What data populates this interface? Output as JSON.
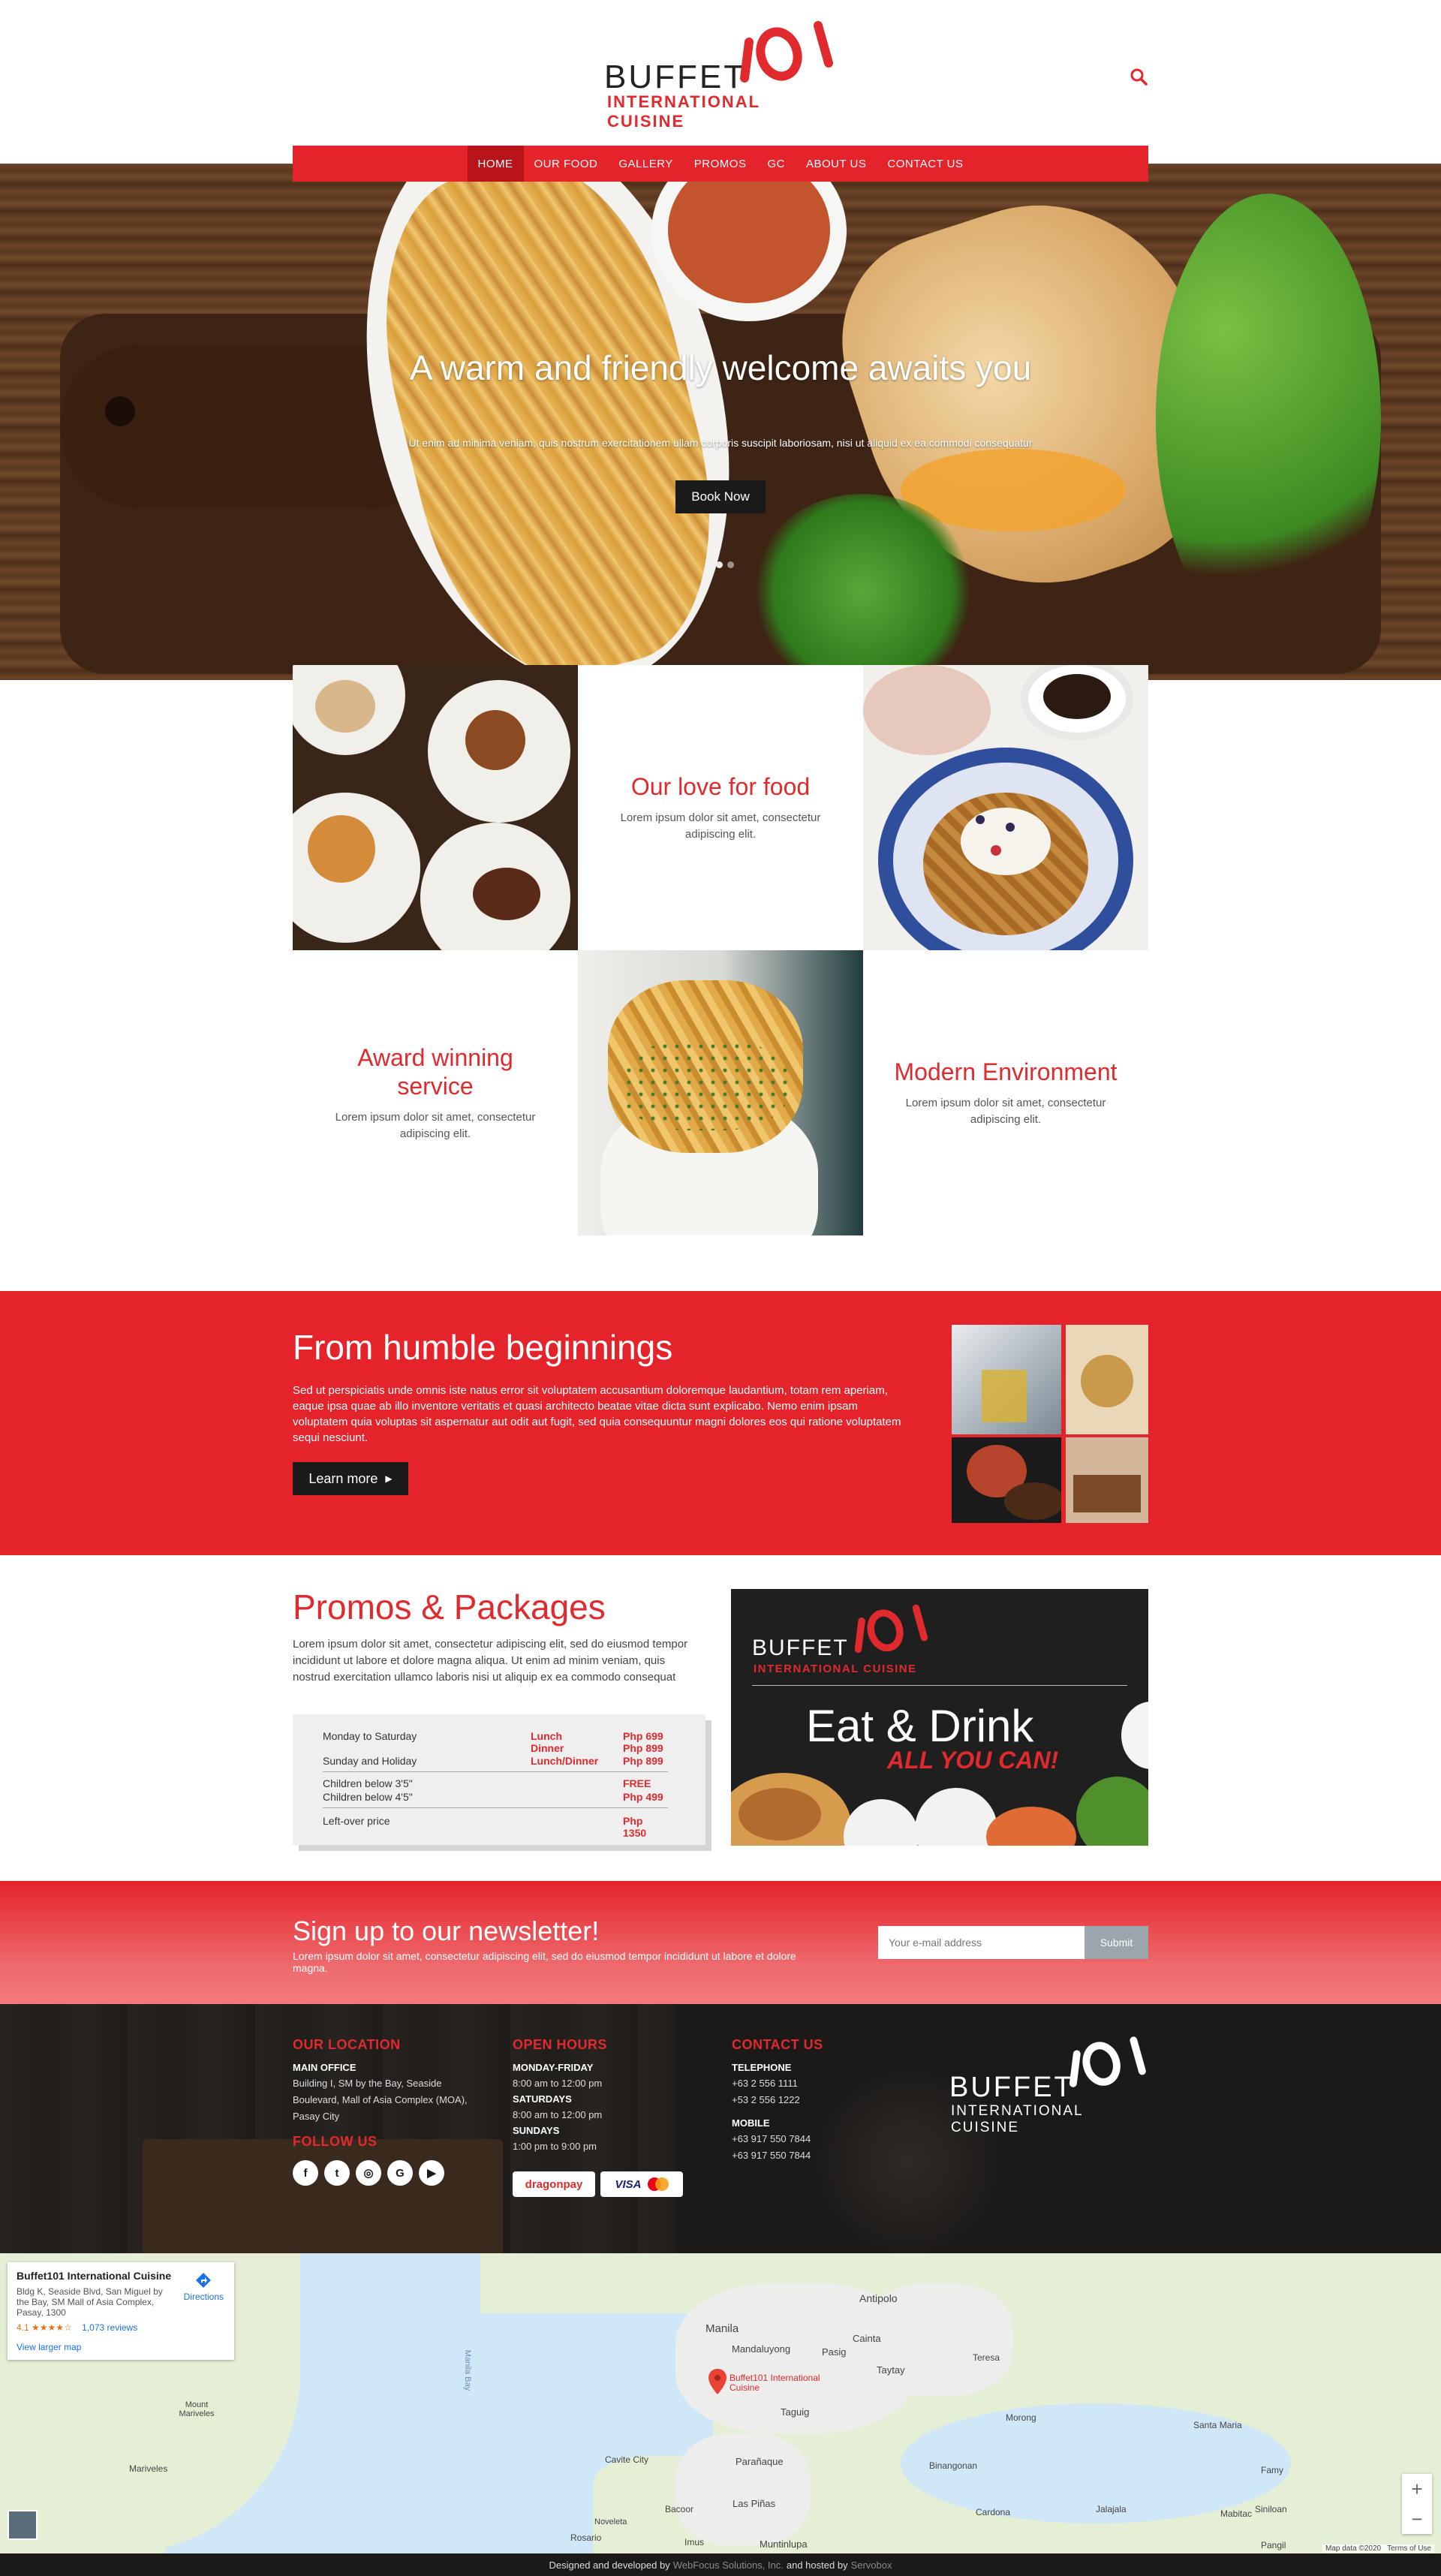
{
  "logo": {
    "buffet": "BUFFET",
    "num": "101",
    "international": "INTERNATIONAL CUISINE"
  },
  "nav": {
    "items": [
      "HOME",
      "OUR FOOD",
      "GALLERY",
      "PROMOS",
      "GC",
      "ABOUT US",
      "CONTACT US"
    ],
    "active": "HOME"
  },
  "hero": {
    "title": "A warm and friendly welcome awaits you",
    "subtitle": "Ut enim ad minima veniam, quis nostrum exercitationem ullam corporis suscipit laboriosam, nisi ut aliquid ex ea commodi consequatur",
    "button": "Book Now"
  },
  "features": [
    {
      "title": "Our love for food",
      "text": "Lorem ipsum dolor sit amet, consectetur adipiscing elit."
    },
    {
      "title": "Award winning service",
      "text": "Lorem ipsum dolor sit amet, consectetur adipiscing elit."
    },
    {
      "title": "Modern Environment",
      "text": "Lorem ipsum dolor sit amet, consectetur adipiscing elit."
    }
  ],
  "humble": {
    "title": "From humble beginnings",
    "text": "Sed ut perspiciatis unde omnis iste natus error sit voluptatem accusantium doloremque laudantium, totam rem aperiam, eaque ipsa quae ab illo inventore veritatis et quasi architecto beatae vitae dicta sunt explicabo. Nemo enim ipsam voluptatem quia voluptas sit aspernatur aut odit aut fugit, sed quia consequuntur magni dolores eos qui ratione voluptatem sequi nesciunt.",
    "button": "Learn more"
  },
  "promos": {
    "title": "Promos & Packages",
    "text": "Lorem ipsum dolor sit amet, consectetur adipiscing elit, sed do eiusmod tempor incididunt ut labore et dolore magna aliqua. Ut enim ad minim veniam, quis nostrud exercitation ullamco laboris nisi ut aliquip ex ea commodo consequat",
    "rows": [
      {
        "label": "Monday to Saturday",
        "meal": "Lunch",
        "price": "Php 699"
      },
      {
        "label": "",
        "meal": "Dinner",
        "price": "Php 899"
      },
      {
        "label": "Sunday and Holiday",
        "meal": "Lunch/Dinner",
        "price": "Php 899"
      },
      {
        "label": "Children below 3'5\"",
        "meal": "",
        "price": "FREE"
      },
      {
        "label": "Children below 4'5\"",
        "meal": "",
        "price": "Php 499"
      },
      {
        "label": "Left-over price",
        "meal": "",
        "price": "Php 1350"
      }
    ],
    "ad": {
      "buffet": "BUFFET",
      "international": "INTERNATIONAL CUISINE",
      "eat": "Eat & Drink",
      "all": "ALL YOU CAN!"
    }
  },
  "newsletter": {
    "title": "Sign up to our newsletter!",
    "text": "Lorem ipsum dolor sit amet, consectetur adipiscing elit, sed do eiusmod tempor incididunt ut labore et dolore magna.",
    "placeholder": "Your e-mail address",
    "submit": "Submit"
  },
  "footer": {
    "location": {
      "title": "OUR LOCATION",
      "key": "MAIN OFFICE",
      "address": "Building I, SM by the Bay, Seaside Boulevard, Mall of Asia Complex (MOA), Pasay City"
    },
    "follow": "FOLLOW US",
    "hours": {
      "title": "OPEN HOURS",
      "rows": [
        {
          "k": "MONDAY-FRIDAY",
          "v": "8:00 am to 12:00 pm"
        },
        {
          "k": "SATURDAYS",
          "v": "8:00 am to 12:00 pm"
        },
        {
          "k": "SUNDAYS",
          "v": "1:00 pm to 9:00 pm"
        }
      ]
    },
    "contact": {
      "title": "CONTACT US",
      "tel_label": "TELEPHONE",
      "tel": [
        "+63 2 556 1111",
        "+53 2 556 1222"
      ],
      "mob_label": "MOBILE",
      "mob": [
        "+63 917 550 7844",
        "+63 917 550 7844"
      ]
    },
    "pay": {
      "dragonpay": "dragonpay",
      "visa": "VISA"
    }
  },
  "map": {
    "name": "Buffet101 International Cuisine",
    "address": "Bldg K, Seaside Blvd, San Miguel by the Bay, SM Mall of Asia Complex, Pasay, 1300",
    "rating": "4.1",
    "stars": "★★★★☆",
    "reviews": "1,073 reviews",
    "larger": "View larger map",
    "directions": "Directions",
    "pin": "Buffet101 International Cuisine",
    "places": [
      "Manila",
      "Antipolo",
      "Cainta",
      "Mandaluyong",
      "Pasig",
      "Taytay",
      "Teresa",
      "Morong",
      "Taguig",
      "Parañaque",
      "Las Piñas",
      "Muntinlupa",
      "Cavite City",
      "Binangonan",
      "Cardona",
      "Jalajala",
      "Mariveles",
      "Mount Mariveles",
      "Bacoor",
      "Imus",
      "Rosario",
      "Noveleta",
      "Santa Maria",
      "Famy",
      "Mabitac",
      "Siniloan",
      "Pangil",
      "Manila Bay"
    ],
    "footer": [
      "Map data ©2020",
      "Terms of Use"
    ]
  },
  "credits": {
    "a": "Designed and developed by",
    "b": "WebFocus Solutions, Inc.",
    "c": "and hosted by",
    "d": "Servobox"
  }
}
